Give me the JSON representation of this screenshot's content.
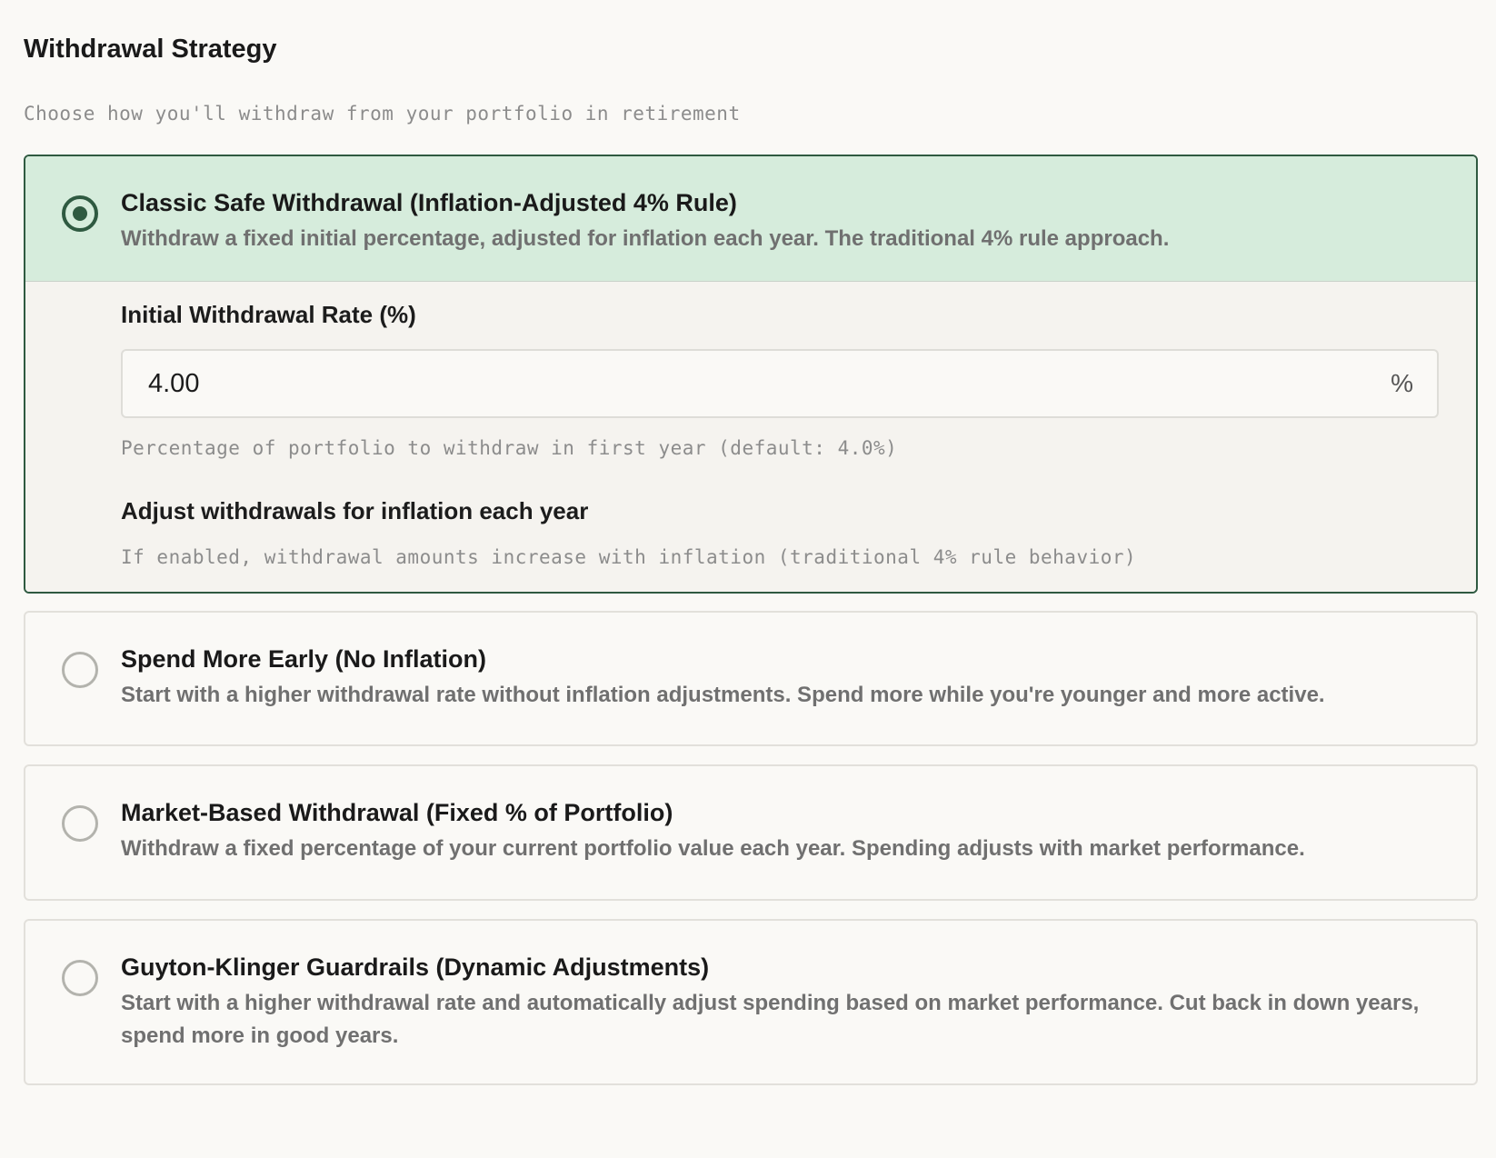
{
  "section": {
    "title": "Withdrawal Strategy",
    "subtitle": "Choose how you'll withdraw from your portfolio in retirement"
  },
  "options": [
    {
      "title": "Classic Safe Withdrawal (Inflation-Adjusted 4% Rule)",
      "description": "Withdraw a fixed initial percentage, adjusted for inflation each year. The traditional 4% rule approach.",
      "selected": true,
      "settings": {
        "rate_label": "Initial Withdrawal Rate (%)",
        "rate_value": "4.00",
        "rate_suffix": "%",
        "rate_hint": "Percentage of portfolio to withdraw in first year (default: 4.0%)",
        "inflation_label": "Adjust withdrawals for inflation each year",
        "inflation_hint": "If enabled, withdrawal amounts increase with inflation (traditional 4% rule behavior)"
      }
    },
    {
      "title": "Spend More Early (No Inflation)",
      "description": "Start with a higher withdrawal rate without inflation adjustments. Spend more while you're younger and more active.",
      "selected": false
    },
    {
      "title": "Market-Based Withdrawal (Fixed % of Portfolio)",
      "description": "Withdraw a fixed percentage of your current portfolio value each year. Spending adjusts with market performance.",
      "selected": false
    },
    {
      "title": "Guyton-Klinger Guardrails (Dynamic Adjustments)",
      "description": "Start with a higher withdrawal rate and automatically adjust spending based on market performance. Cut back in down years, spend more in good years.",
      "selected": false
    }
  ],
  "colors": {
    "accent": "#2f5a41",
    "selected_bg": "#d6ecdc"
  }
}
